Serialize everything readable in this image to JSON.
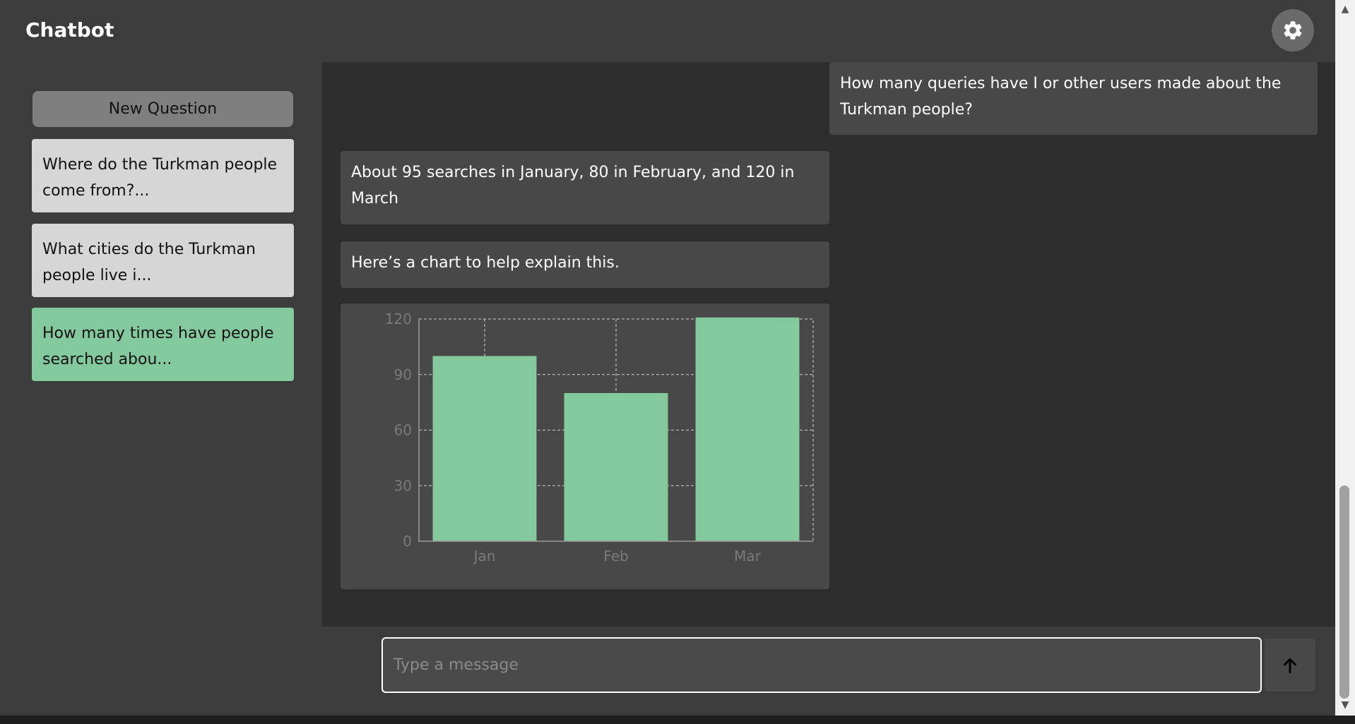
{
  "app": {
    "title": "Chatbot"
  },
  "header": {
    "settings_icon": "gear-icon"
  },
  "sidebar": {
    "new_question_label": "New Question",
    "items": [
      {
        "label": "Where do the Turkman people come from?...",
        "active": false
      },
      {
        "label": "What cities do the Turkman people live i...",
        "active": false
      },
      {
        "label": "How many times have people searched abou...",
        "active": true
      }
    ]
  },
  "chat": {
    "messages": [
      {
        "role": "user",
        "text": "How many queries have I or other users made about the Turkman people?"
      },
      {
        "role": "bot",
        "text": "About 95 searches in January, 80 in February, and 120 in March"
      },
      {
        "role": "bot",
        "text": "Here’s a chart to help explain this."
      }
    ]
  },
  "input": {
    "placeholder": "Type a message",
    "value": "",
    "send_icon": "arrow-up-icon"
  },
  "colors": {
    "accent": "#83c99d",
    "bubble": "#484848",
    "chat_bg": "#2d2d2d",
    "panel_bg": "#3c3c3c"
  },
  "chart_data": {
    "type": "bar",
    "categories": [
      "Jan",
      "Feb",
      "Mar"
    ],
    "values": [
      100,
      80,
      123
    ],
    "ylim": [
      0,
      120
    ],
    "yticks": [
      0,
      30,
      60,
      90,
      120
    ],
    "grid": true,
    "bar_color": "#83c99d"
  }
}
